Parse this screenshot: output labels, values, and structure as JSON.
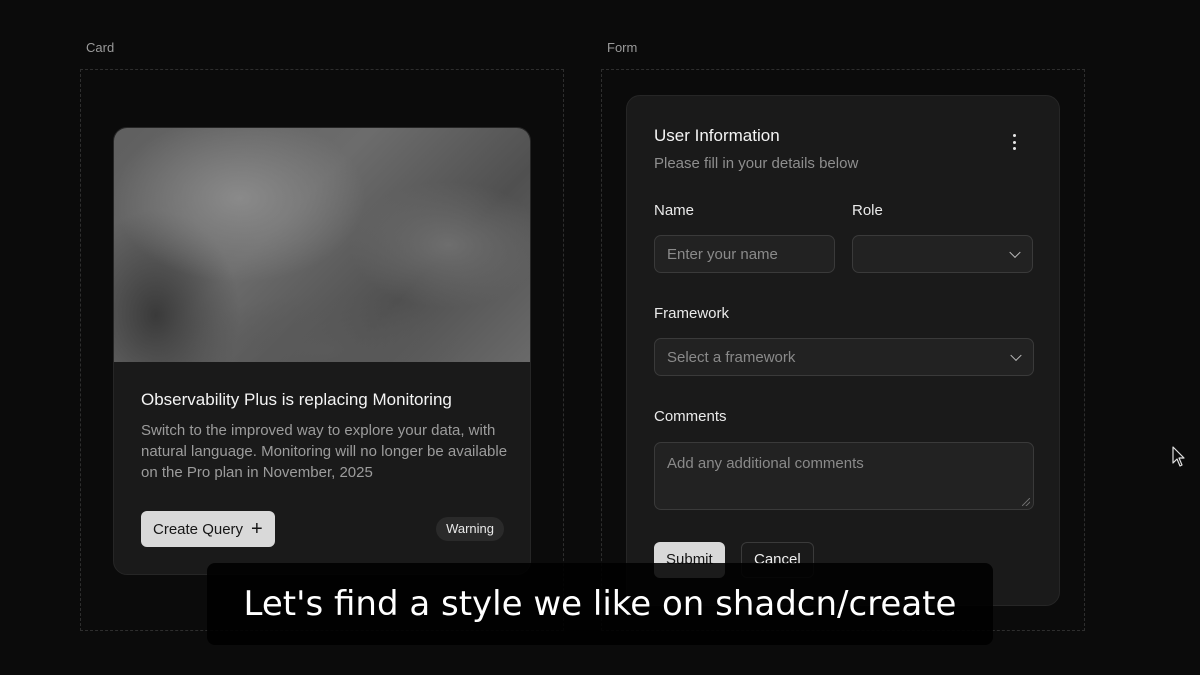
{
  "sections": {
    "card_label": "Card",
    "form_label": "Form"
  },
  "card": {
    "title": "Observability Plus is replacing Monitoring",
    "description": "Switch to the improved way to explore your data, with natural language. Monitoring will no longer be available on the Pro plan in November, 2025",
    "button_label": "Create Query",
    "button_icon": "plus-icon",
    "badge": "Warning"
  },
  "form": {
    "title": "User Information",
    "description": "Please fill in your details below",
    "menu_icon": "kebab-icon",
    "name_label": "Name",
    "name_placeholder": "Enter your name",
    "role_label": "Role",
    "role_value": "",
    "framework_label": "Framework",
    "framework_placeholder": "Select a framework",
    "comments_label": "Comments",
    "comments_placeholder": "Add any additional comments",
    "submit_label": "Submit",
    "cancel_label": "Cancel"
  },
  "caption": "Let's find a style we like on shadcn/create",
  "colors": {
    "background": "#0b0b0b",
    "card_background": "#1a1a1a",
    "primary_button": "#d9d9d9",
    "muted_text": "#9c9c9c"
  }
}
